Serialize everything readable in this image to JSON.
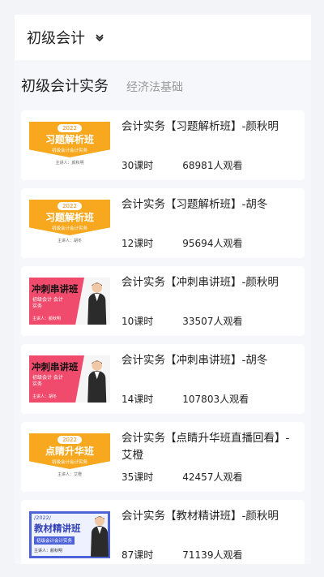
{
  "header": {
    "title": "初级会计",
    "chevron_icon": "chevron-down-icon"
  },
  "tabs": [
    {
      "label": "初级会计实务",
      "active": true
    },
    {
      "label": "经济法基础",
      "active": false
    }
  ],
  "courses": [
    {
      "title": "会计实务【习题解析班】-颜秋明",
      "lessons": "30课时",
      "views": "68981人观看",
      "thumb": {
        "style": "orange",
        "year": "2022",
        "big": "习题解析班",
        "sub": "初级会计会计实务",
        "who": "主讲人：颜秋明"
      }
    },
    {
      "title": "会计实务【习题解析班】-胡冬",
      "lessons": "12课时",
      "views": "95694人观看",
      "thumb": {
        "style": "orange",
        "year": "2022",
        "big": "习题解析班",
        "sub": "初级会计会计实务",
        "who": "主讲人：胡冬"
      }
    },
    {
      "title": "会计实务【冲刺串讲班】-颜秋明",
      "lessons": "10课时",
      "views": "33507人观看",
      "thumb": {
        "style": "pink",
        "big": "冲刺串讲班",
        "sub": "初级会计 会计实务",
        "who": "主讲人：颜秋明"
      }
    },
    {
      "title": "会计实务【冲刺串讲班】-胡冬",
      "lessons": "14课时",
      "views": "107803人观看",
      "thumb": {
        "style": "pink",
        "big": "冲刺串讲班",
        "sub": "初级会计 会计实务",
        "who": "主讲人：胡冬"
      }
    },
    {
      "title": "会计实务【点睛升华班直播回看】-艾橙",
      "lessons": "35课时",
      "views": "42457人观看",
      "thumb": {
        "style": "orange",
        "year": "2022",
        "big": "点睛升华班",
        "sub": "初级会计会计实务",
        "who": "主讲人：艾橙"
      }
    },
    {
      "title": "会计实务【教材精讲班】-颜秋明",
      "lessons": "87课时",
      "views": "71139人观看",
      "thumb": {
        "style": "blue",
        "year": "/2022/",
        "big": "教材精讲班",
        "sub": "初级会计会计实务",
        "who": "主讲人：颜秋明"
      }
    }
  ],
  "colors": {
    "accent_orange": "#f7a81e",
    "accent_pink": "#f04b6d",
    "accent_blue": "#4f63d9"
  }
}
